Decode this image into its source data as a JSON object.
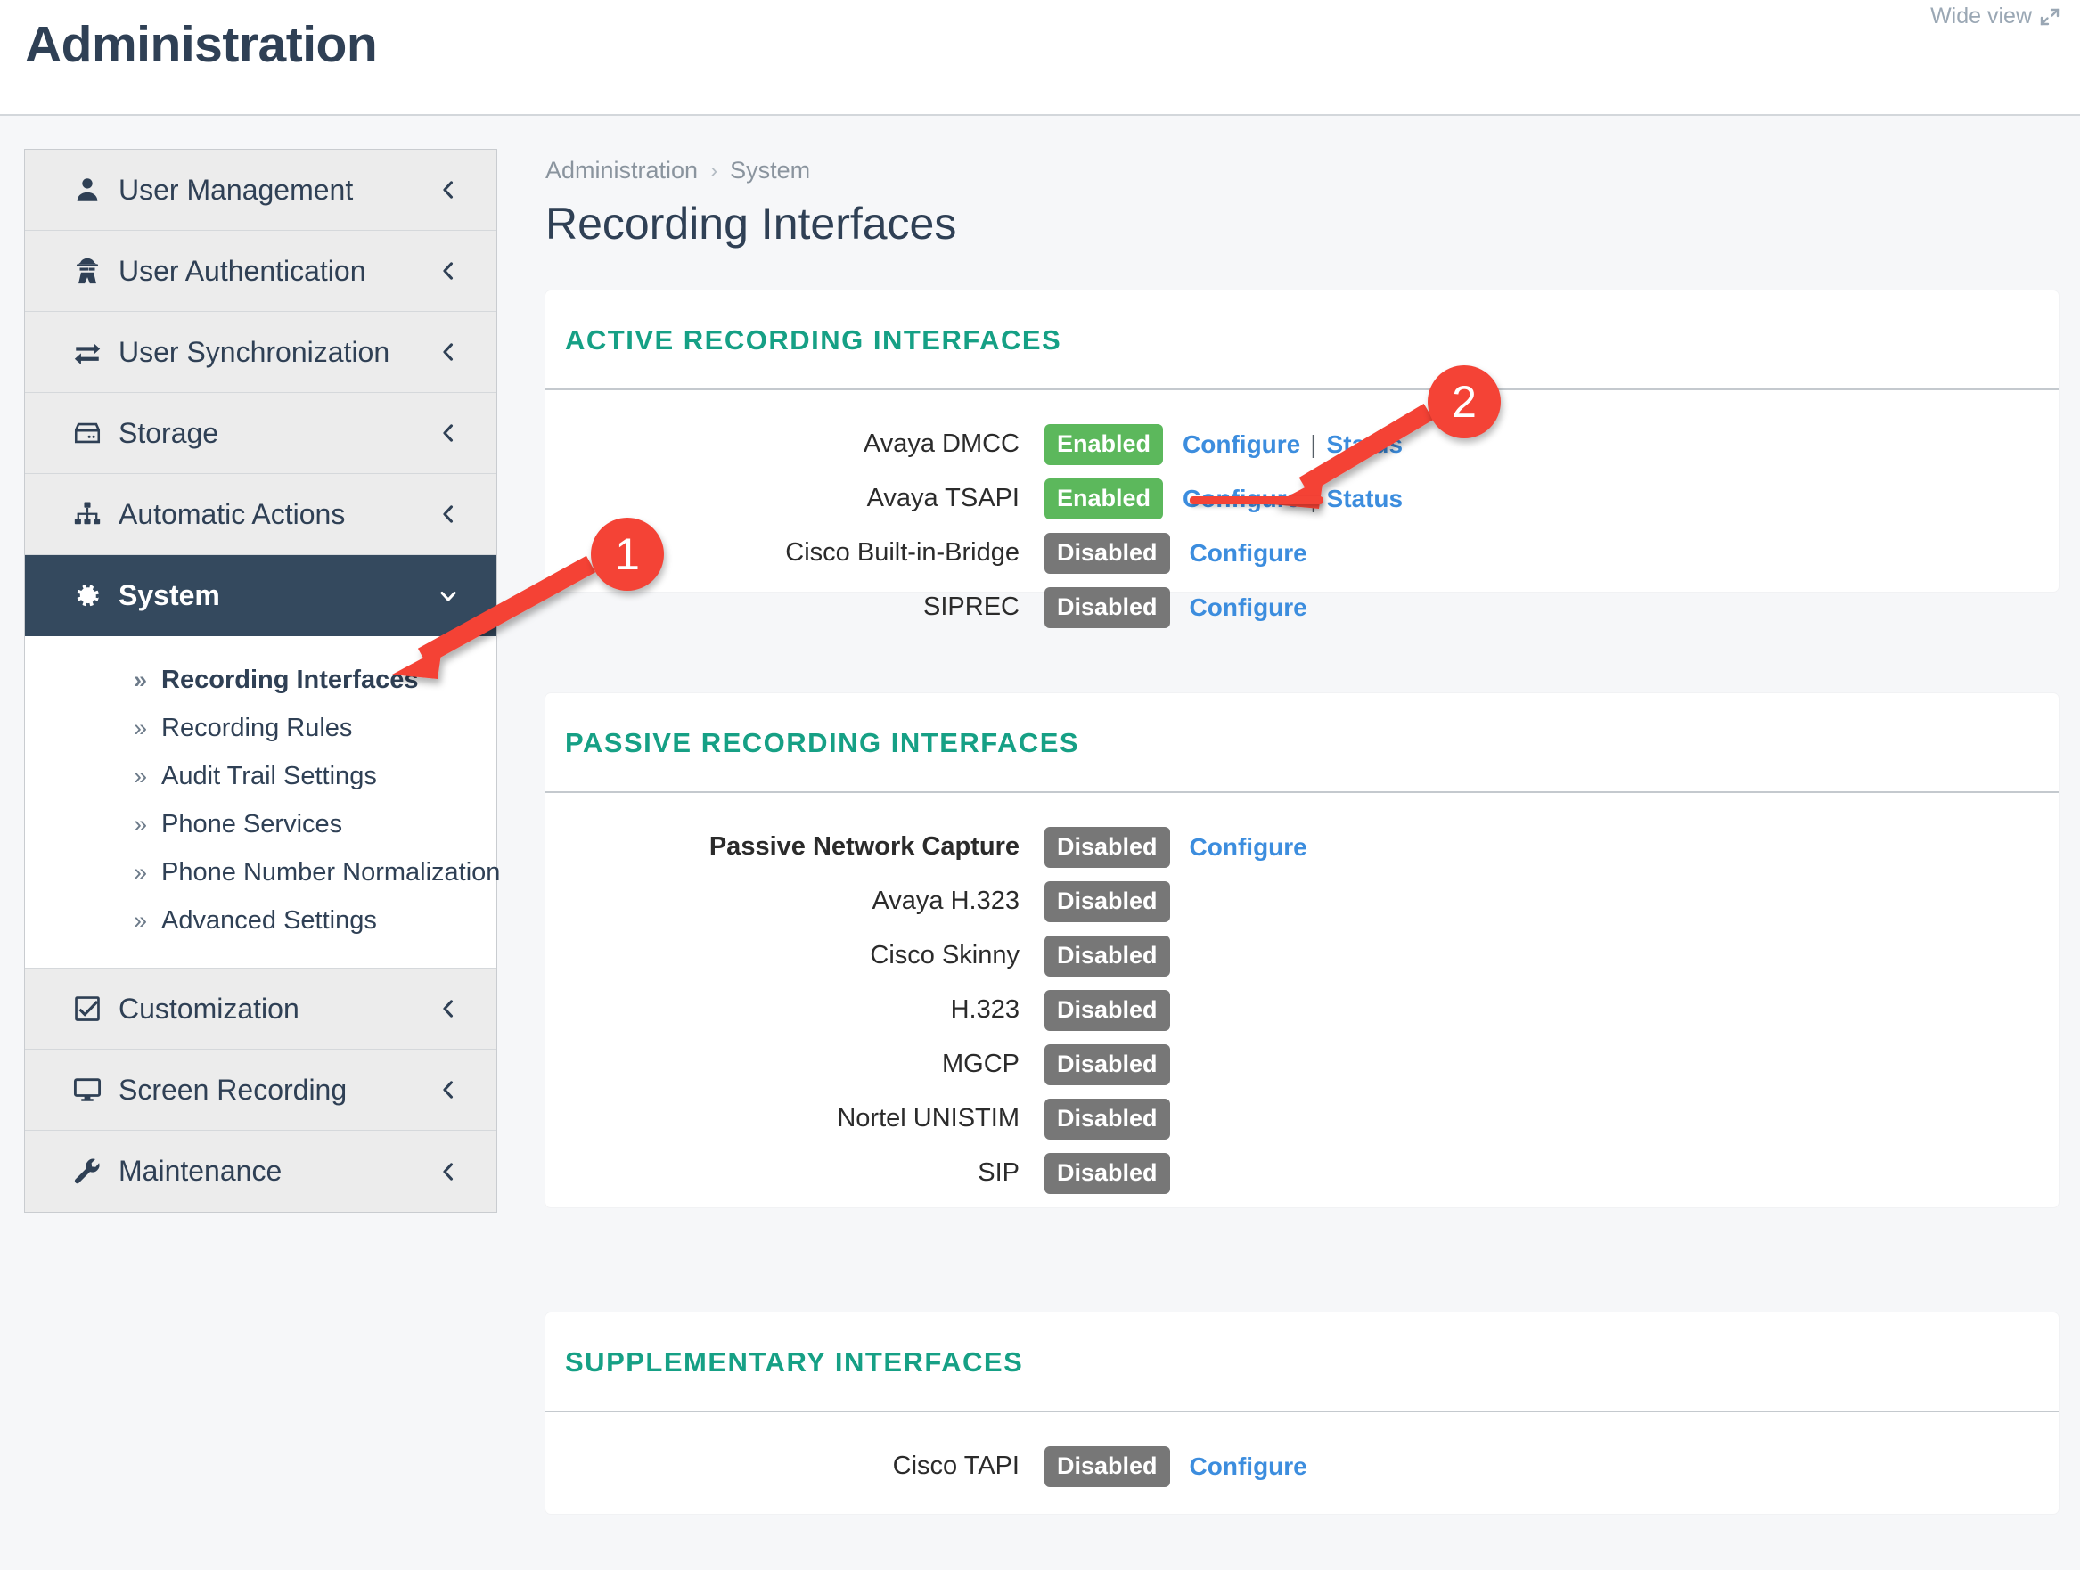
{
  "header": {
    "title": "Administration",
    "wide_view_label": "Wide view",
    "wide_view_icon": "expand-diagonal-icon"
  },
  "sidebar": {
    "items": [
      {
        "label": "User Management",
        "icon": "user-icon",
        "chevron": "chevron-left-icon",
        "active": false
      },
      {
        "label": "User Authentication",
        "icon": "user-secret-icon",
        "chevron": "chevron-left-icon",
        "active": false
      },
      {
        "label": "User Synchronization",
        "icon": "exchange-icon",
        "chevron": "chevron-left-icon",
        "active": false
      },
      {
        "label": "Storage",
        "icon": "hdd-icon",
        "chevron": "chevron-left-icon",
        "active": false
      },
      {
        "label": "Automatic Actions",
        "icon": "sitemap-icon",
        "chevron": "chevron-left-icon",
        "active": false
      },
      {
        "label": "System",
        "icon": "gear-icon",
        "chevron": "chevron-down-icon",
        "active": true
      },
      {
        "label": "Customization",
        "icon": "check-square-icon",
        "chevron": "chevron-left-icon",
        "active": false
      },
      {
        "label": "Screen Recording",
        "icon": "desktop-icon",
        "chevron": "chevron-left-icon",
        "active": false
      },
      {
        "label": "Maintenance",
        "icon": "wrench-icon",
        "chevron": "chevron-left-icon",
        "active": false
      }
    ],
    "submenu": [
      {
        "label": "Recording Interfaces",
        "current": true
      },
      {
        "label": "Recording Rules",
        "current": false
      },
      {
        "label": "Audit Trail Settings",
        "current": false
      },
      {
        "label": "Phone Services",
        "current": false
      },
      {
        "label": "Phone Number Normalization",
        "current": false
      },
      {
        "label": "Advanced Settings",
        "current": false
      }
    ],
    "submenu_bullet": "»"
  },
  "main": {
    "breadcrumb": {
      "root": "Administration",
      "separator": "›",
      "leaf": "System"
    },
    "page_title": "Recording Interfaces",
    "panels": [
      {
        "title": "ACTIVE RECORDING INTERFACES",
        "rows": [
          {
            "name": "Avaya DMCC",
            "status": "Enabled",
            "state": "enabled",
            "bold": false,
            "links": [
              "Configure",
              "Status"
            ]
          },
          {
            "name": "Avaya TSAPI",
            "status": "Enabled",
            "state": "enabled",
            "bold": false,
            "links": [
              "Configure",
              "Status"
            ]
          },
          {
            "name": "Cisco Built-in-Bridge",
            "status": "Disabled",
            "state": "disabled",
            "bold": false,
            "links": [
              "Configure"
            ]
          },
          {
            "name": "SIPREC",
            "status": "Disabled",
            "state": "disabled",
            "bold": false,
            "links": [
              "Configure"
            ]
          }
        ]
      },
      {
        "title": "PASSIVE RECORDING INTERFACES",
        "rows": [
          {
            "name": "Passive Network Capture",
            "status": "Disabled",
            "state": "disabled",
            "bold": true,
            "links": [
              "Configure"
            ]
          },
          {
            "name": "Avaya H.323",
            "status": "Disabled",
            "state": "disabled",
            "bold": false,
            "links": []
          },
          {
            "name": "Cisco Skinny",
            "status": "Disabled",
            "state": "disabled",
            "bold": false,
            "links": []
          },
          {
            "name": "H.323",
            "status": "Disabled",
            "state": "disabled",
            "bold": false,
            "links": []
          },
          {
            "name": "MGCP",
            "status": "Disabled",
            "state": "disabled",
            "bold": false,
            "links": []
          },
          {
            "name": "Nortel UNISTIM",
            "status": "Disabled",
            "state": "disabled",
            "bold": false,
            "links": []
          },
          {
            "name": "SIP",
            "status": "Disabled",
            "state": "disabled",
            "bold": false,
            "links": []
          }
        ]
      },
      {
        "title": "SUPPLEMENTARY INTERFACES",
        "rows": [
          {
            "name": "Cisco TAPI",
            "status": "Disabled",
            "state": "disabled",
            "bold": false,
            "links": [
              "Configure"
            ]
          }
        ]
      }
    ],
    "link_separator": "|"
  },
  "annotations": {
    "markers": [
      {
        "number": "1",
        "target": "Recording Interfaces sidebar item"
      },
      {
        "number": "2",
        "target": "Avaya TSAPI Status link"
      }
    ]
  },
  "colors": {
    "accent_green": "#16a085",
    "enabled_badge": "#5cb85c",
    "disabled_badge": "#777777",
    "link_blue": "#3c8dde",
    "sidebar_active": "#34495e",
    "annotation_red": "#f44336",
    "title_navy": "#2f4055"
  }
}
